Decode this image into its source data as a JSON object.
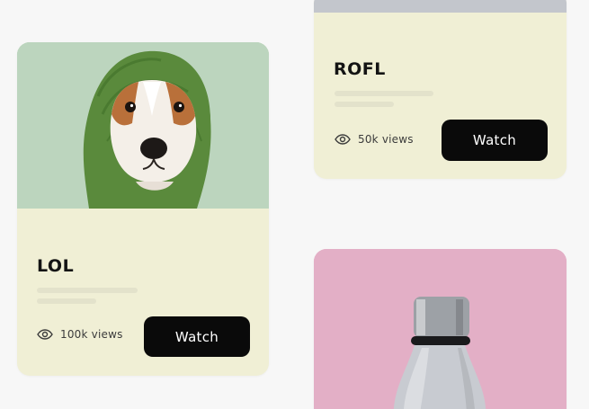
{
  "cards": [
    {
      "title": "LOL",
      "views": "100k views",
      "watch_label": "Watch",
      "image": {
        "subject": "dog wearing a green knitted hood"
      }
    },
    {
      "title": "ROFL",
      "views": "50k views",
      "watch_label": "Watch"
    },
    {
      "image": {
        "subject": "pink background with a grey water bottle"
      }
    }
  ],
  "icons": {
    "views": "eye-icon"
  },
  "colors": {
    "card_background": "#f0efd5",
    "button_background": "#0a0a0a",
    "button_text": "#ffffff",
    "text_primary": "#141414",
    "pink_background": "#e6b2c8",
    "top_bar": "#c3c6cc"
  }
}
